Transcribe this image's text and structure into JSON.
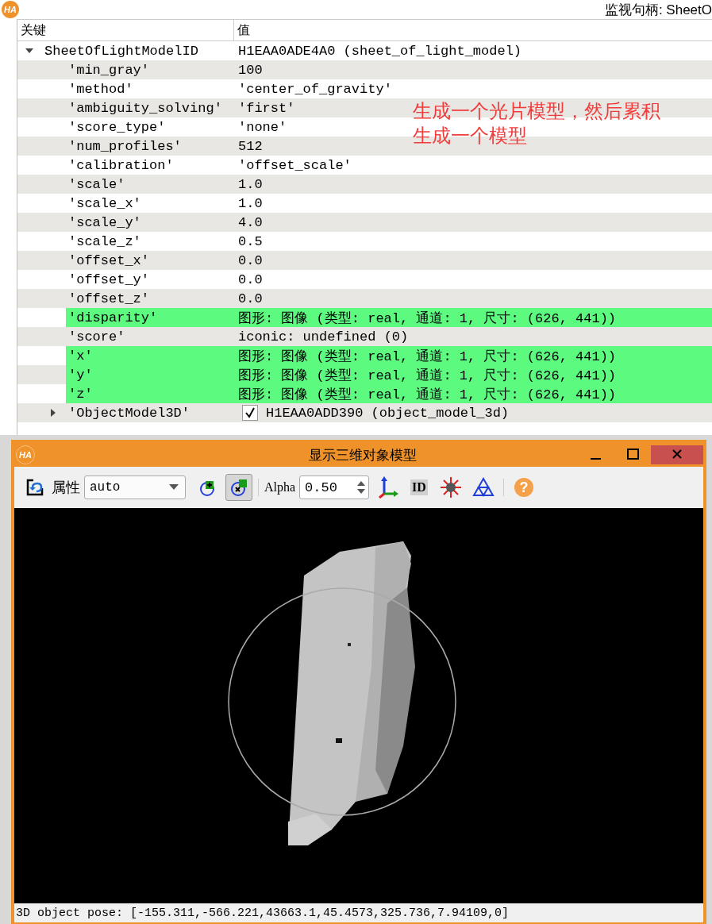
{
  "header": {
    "logo": "HA",
    "title": "监视句柄: SheetO"
  },
  "table": {
    "columns": [
      "关键",
      "值"
    ],
    "rows": [
      {
        "key": "SheetOfLightModelID",
        "value": "H1EAA0ADE4A0 (sheet_of_light_model)",
        "expanded": true,
        "children": [
          {
            "key": "'min_gray'",
            "value": "100",
            "highlighted": false
          },
          {
            "key": "'method'",
            "value": "'center_of_gravity'",
            "highlighted": false
          },
          {
            "key": "'ambiguity_solving'",
            "value": "'first'",
            "highlighted": false
          },
          {
            "key": "'score_type'",
            "value": "'none'",
            "highlighted": false
          },
          {
            "key": "'num_profiles'",
            "value": "512",
            "highlighted": false
          },
          {
            "key": "'calibration'",
            "value": "'offset_scale'",
            "highlighted": false
          },
          {
            "key": "'scale'",
            "value": "1.0",
            "highlighted": false
          },
          {
            "key": "'scale_x'",
            "value": "1.0",
            "highlighted": false
          },
          {
            "key": "'scale_y'",
            "value": "4.0",
            "highlighted": false
          },
          {
            "key": "'scale_z'",
            "value": "0.5",
            "highlighted": false
          },
          {
            "key": "'offset_x'",
            "value": "0.0",
            "highlighted": false
          },
          {
            "key": "'offset_y'",
            "value": "0.0",
            "highlighted": false
          },
          {
            "key": "'offset_z'",
            "value": "0.0",
            "highlighted": false
          },
          {
            "key": "'disparity'",
            "value": "图形: 图像 (类型: real, 通道: 1, 尺寸: (626, 441))",
            "highlighted": true
          },
          {
            "key": "'score'",
            "value": "iconic: undefined (0)",
            "highlighted": false
          },
          {
            "key": "'x'",
            "value": "图形: 图像 (类型: real, 通道: 1, 尺寸: (626, 441))",
            "highlighted": true
          },
          {
            "key": "'y'",
            "value": "图形: 图像 (类型: real, 通道: 1, 尺寸: (626, 441))",
            "highlighted": true
          },
          {
            "key": "'z'",
            "value": "图形: 图像 (类型: real, 通道: 1, 尺寸: (626, 441))",
            "highlighted": true
          }
        ]
      },
      {
        "key": "'ObjectModel3D'",
        "value": "H1EAA0ADD390 (object_model_3d)",
        "expanded": false,
        "checked": true,
        "children": []
      }
    ]
  },
  "annotation": [
    "生成一个光片模型，然后累积",
    "生成一个模型"
  ],
  "viewer": {
    "logo": "HA",
    "title": "显示三维对象模型",
    "attribute_label": "属性",
    "attribute_value": "auto",
    "toggles": [
      {
        "kind": "add",
        "pressed": false
      },
      {
        "kind": "remove",
        "pressed": true
      }
    ],
    "alpha_label": "Alpha",
    "alpha_value": "0.50",
    "tools": [
      {
        "kind": "axes"
      },
      {
        "kind": "id",
        "label": "ID"
      },
      {
        "kind": "light"
      },
      {
        "kind": "triangles"
      },
      {
        "kind": "help",
        "label": "?"
      }
    ],
    "status": "3D object pose: [-155.311,-566.221,43663.1,45.4573,325.736,7.94109,0]"
  }
}
